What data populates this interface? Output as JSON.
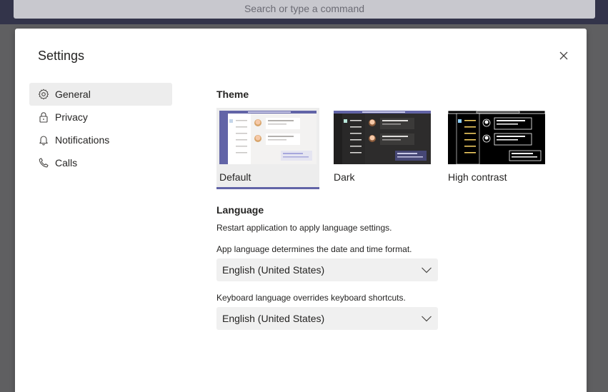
{
  "search": {
    "placeholder": "Search or type a command"
  },
  "dialog": {
    "title": "Settings"
  },
  "nav": {
    "items": [
      {
        "label": "General",
        "icon": "gear-icon",
        "active": true
      },
      {
        "label": "Privacy",
        "icon": "lock-icon",
        "active": false
      },
      {
        "label": "Notifications",
        "icon": "bell-icon",
        "active": false
      },
      {
        "label": "Calls",
        "icon": "phone-icon",
        "active": false
      }
    ]
  },
  "theme": {
    "heading": "Theme",
    "options": [
      {
        "label": "Default",
        "selected": true
      },
      {
        "label": "Dark",
        "selected": false
      },
      {
        "label": "High contrast",
        "selected": false
      }
    ]
  },
  "language": {
    "heading": "Language",
    "restart_note": "Restart application to apply language settings.",
    "app_language_note": "App language determines the date and time format.",
    "app_language_value": "English (United States)",
    "keyboard_language_note": "Keyboard language overrides keyboard shortcuts.",
    "keyboard_language_value": "English (United States)"
  },
  "colors": {
    "accent": "#6264a7",
    "topbar": "#33344a",
    "overlay": "#5f5f61"
  }
}
